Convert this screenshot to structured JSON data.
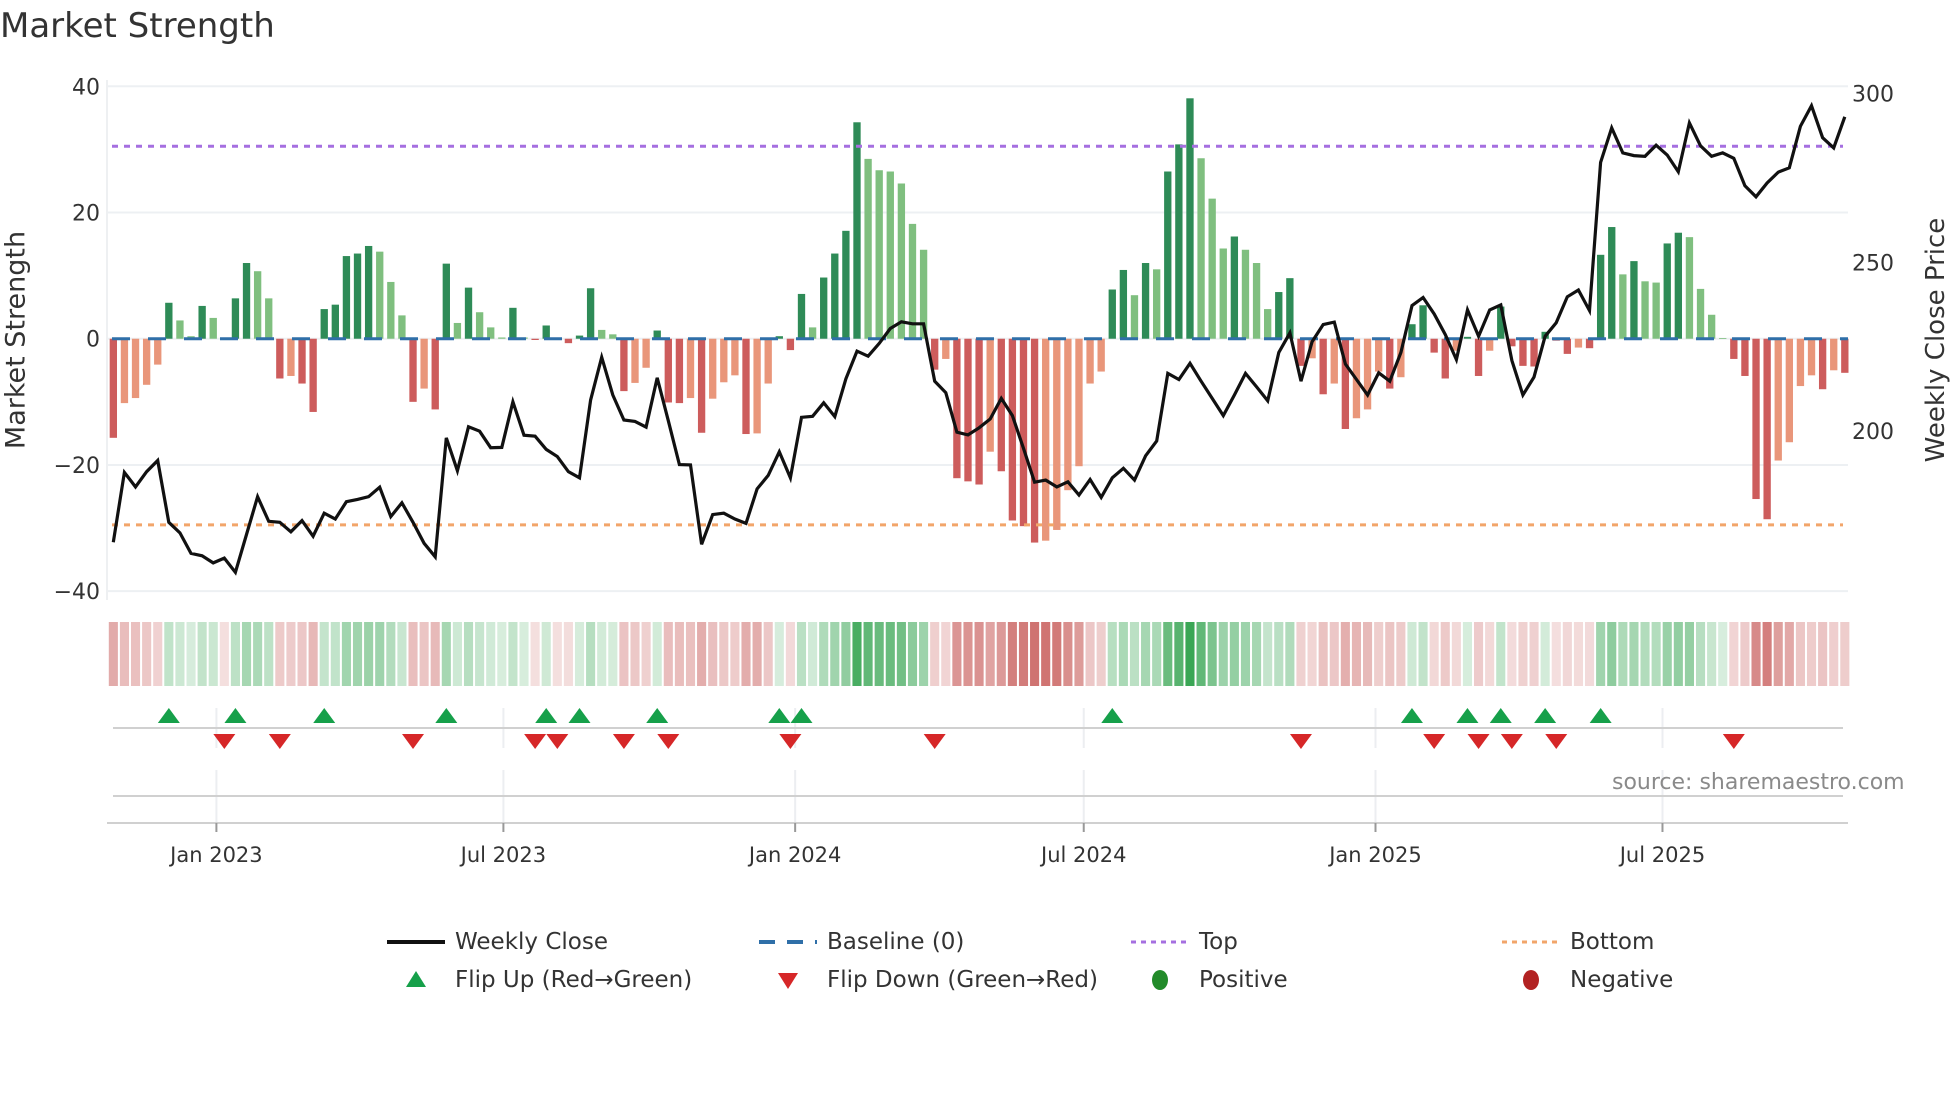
{
  "title": "Market Strength",
  "source": "source: sharemaestro.com",
  "legend": [
    {
      "label": "Weekly Close",
      "icon": "solid-line",
      "color": "#111111"
    },
    {
      "label": "Baseline (0)",
      "icon": "dashed-line",
      "color": "#2f6fa8"
    },
    {
      "label": "Top",
      "icon": "dotted-line",
      "color": "#a56fe0"
    },
    {
      "label": "Bottom",
      "icon": "dotted-line",
      "color": "#f2a56a"
    },
    {
      "label": "Flip Up (Red→Green)",
      "icon": "triangle-up",
      "color": "#16a04a"
    },
    {
      "label": "Flip Down (Green→Red)",
      "icon": "triangle-down",
      "color": "#d62728"
    },
    {
      "label": "Positive",
      "icon": "circle",
      "color": "#228b2a"
    },
    {
      "label": "Negative",
      "icon": "circle",
      "color": "#b22222"
    }
  ],
  "colors": {
    "pos_rising": "#2e8b57",
    "pos_falling": "#7fbf7f",
    "neg_falling": "#cd5c5c",
    "neg_rising": "#e9967a",
    "strip_pos": "#3aa655",
    "strip_neg": "#c9605e",
    "line": "#111111",
    "baseline": "#2f6fa8",
    "top": "#a56fe0",
    "bottom": "#f2a56a",
    "flip_up": "#16a04a",
    "flip_down": "#d62728"
  },
  "chart_data": {
    "type": "bar+line",
    "title": "Market Strength",
    "xlabel": "",
    "ylabel": "Market Strength",
    "ylabel_right": "Weekly Close Price",
    "start_date": "2022-10-28",
    "frequency": "weekly",
    "xlim": [
      "2022-10-24",
      "2025-10-26"
    ],
    "ylim": [
      -41.4,
      41.0
    ],
    "ylim_right": [
      150,
      304
    ],
    "yticks": [
      {
        "value": 40,
        "label": "40"
      },
      {
        "value": 20,
        "label": "20"
      },
      {
        "value": 0,
        "label": "0"
      },
      {
        "value": -20,
        "label": "−20"
      },
      {
        "value": -40,
        "label": "−40"
      }
    ],
    "yticks_right": [
      {
        "value": 300,
        "label": "300"
      },
      {
        "value": 250,
        "label": "250"
      },
      {
        "value": 200,
        "label": "200"
      }
    ],
    "xticks": [
      {
        "date": "2023-01-01",
        "label": "Jan 2023"
      },
      {
        "date": "2023-07-01",
        "label": "Jul 2023"
      },
      {
        "date": "2024-01-01",
        "label": "Jan 2024"
      },
      {
        "date": "2024-07-01",
        "label": "Jul 2024"
      },
      {
        "date": "2025-01-01",
        "label": "Jan 2025"
      },
      {
        "date": "2025-07-01",
        "label": "Jul 2025"
      }
    ],
    "top_level": 30.5,
    "bottom_level": -29.5,
    "baseline": 0,
    "grid": true,
    "legend_position": "bottom",
    "strength": [
      -15.7,
      -10.2,
      -9.4,
      -7.3,
      -4.1,
      5.7,
      2.9,
      0.4,
      5.2,
      3.3,
      -0.2,
      6.4,
      12,
      10.7,
      6.4,
      -6.3,
      -5.9,
      -7.1,
      -11.6,
      4.7,
      5.4,
      13.1,
      13.5,
      14.7,
      13.8,
      9,
      3.7,
      -10,
      -7.9,
      -11.2,
      11.9,
      2.5,
      8.1,
      4.2,
      1.8,
      0.2,
      4.9,
      0.2,
      -0.2,
      2.1,
      -0.2,
      -0.7,
      0.5,
      8,
      1.4,
      0.7,
      -8.3,
      -7,
      -4.6,
      1.3,
      -10.1,
      -10.2,
      -9.4,
      -14.9,
      -9.5,
      -6.9,
      -5.8,
      -15.1,
      -15.0,
      -7.1,
      0.4,
      -1.8,
      7.1,
      1.8,
      9.7,
      13.5,
      17.1,
      34.3,
      28.5,
      26.7,
      26.5,
      24.6,
      18.2,
      14.1,
      -4.9,
      -3.2,
      -22.1,
      -22.6,
      -23.1,
      -17.9,
      -21,
      -28.8,
      -29.7,
      -32.3,
      -32,
      -30.3,
      -24,
      -20.2,
      -7.1,
      -5.2,
      7.8,
      10.9,
      6.9,
      12,
      11,
      26.5,
      30.8,
      38.1,
      28.6,
      22.2,
      14.3,
      16.2,
      14.1,
      12,
      4.7,
      7.4,
      9.6,
      -4.3,
      -3.1,
      -8.8,
      -7.1,
      -14.3,
      -12.6,
      -11.2,
      -5.2,
      -7.9,
      -6.1,
      2.3,
      5.3,
      -2.2,
      -6.3,
      -1.9,
      0.3,
      -5.9,
      -1.9,
      5.1,
      -1.2,
      -4.3,
      -4.4,
      1.1,
      -0.3,
      -2.4,
      -1.4,
      -1.5,
      13.3,
      17.7,
      10.2,
      12.3,
      9.1,
      8.9,
      15.1,
      16.8,
      16.1,
      7.9,
      3.8,
      0.1,
      -3.2,
      -5.9,
      -25.4,
      -28.6,
      -19.3,
      -16.4,
      -7.5,
      -5.8,
      -8,
      -5,
      -5.4
    ],
    "weekly_close": [
      167.1,
      187.8,
      183.5,
      188,
      191.3,
      173,
      169.9,
      163.8,
      163.1,
      161,
      162.4,
      158.2,
      169.4,
      180.6,
      173.3,
      173,
      170.2,
      173.5,
      168.9,
      175.7,
      174,
      179.1,
      179.8,
      180.6,
      183.4,
      174.7,
      178.8,
      173,
      166.8,
      162.8,
      198,
      188.3,
      201.3,
      200,
      195.1,
      195.2,
      208.7,
      198.8,
      198.5,
      194.6,
      192.5,
      188,
      186.2,
      209.2,
      221.9,
      210.7,
      203.3,
      202.9,
      201.2,
      215.8,
      203.1,
      190.1,
      190,
      166.5,
      175.3,
      175.7,
      174,
      172.7,
      182.9,
      186.9,
      193.9,
      186.2,
      204.1,
      204.4,
      208.4,
      204.3,
      215.5,
      223.7,
      222.2,
      226,
      230.4,
      232.4,
      231.8,
      231.8,
      214.8,
      211.4,
      199.7,
      198.9,
      201,
      203.6,
      209.7,
      204.6,
      194.9,
      184.9,
      185.5,
      183.5,
      185,
      181.1,
      185.7,
      180.4,
      186.2,
      189,
      185.5,
      192.7,
      197.1,
      217.1,
      215.3,
      220.1,
      214.8,
      209.7,
      204.6,
      210.7,
      217.1,
      213.1,
      209,
      223.3,
      229.1,
      214.8,
      226.5,
      231.6,
      232.3,
      219.9,
      215.3,
      210.7,
      217.3,
      214.8,
      223.3,
      237.2,
      239.6,
      234.7,
      228.6,
      221.2,
      235.9,
      228.1,
      235.9,
      237.4,
      220.9,
      210.7,
      216,
      228.1,
      232.1,
      239.8,
      241.8,
      235.7,
      279.6,
      289.8,
      282.4,
      281.6,
      281.4,
      284.7,
      281.8,
      276.8,
      291.3,
      284.5,
      281.4,
      282.4,
      280.8,
      272.7,
      269.4,
      273.5,
      276.7,
      278,
      290.3,
      296.4,
      286.9,
      283.9,
      293.1
    ]
  }
}
